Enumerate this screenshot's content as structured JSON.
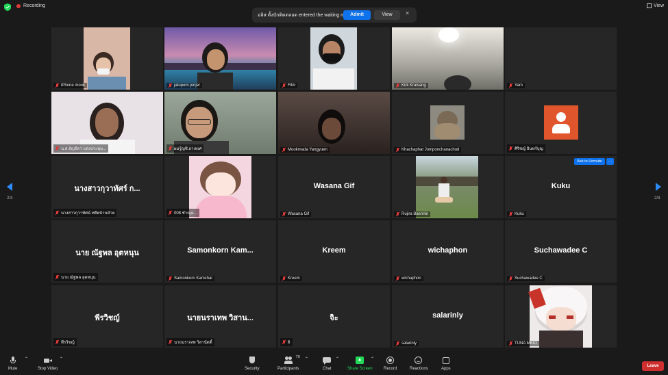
{
  "topbar": {
    "recording_label": "Recording",
    "view_label": "View"
  },
  "notification": {
    "message": "อลิส ตั้งบักติดตลอด entered the waiting room",
    "admit_label": "Admit",
    "view_label": "View",
    "close_glyph": "×"
  },
  "navigation": {
    "left_page": "2/3",
    "right_page": "2/3"
  },
  "tiles": [
    {
      "label": "iPhone mook",
      "center": ""
    },
    {
      "label": "jatuporn jonjer",
      "center": ""
    },
    {
      "label": "Film",
      "center": ""
    },
    {
      "label": "Kirk Kraisang",
      "center": ""
    },
    {
      "label": "Yam",
      "center": ""
    },
    {
      "label": "น.ส.ธัญธิดา แสงประทุม...",
      "center": ""
    },
    {
      "label": "ผมรู้ญชิ.ถาเทเศ",
      "center": ""
    },
    {
      "label": "Mookmada Yangyuen",
      "center": ""
    },
    {
      "label": "Khachaphat Jomponchanachod",
      "center": ""
    },
    {
      "label": "ศิริชญ์ อินทร์บุญ",
      "center": ""
    },
    {
      "label": "นางสาวกุวาทัศน์ ทศิตบ้านห้วย",
      "center": "นางสาวกุวาทัศร์ ก..."
    },
    {
      "label": "008 ชำณุฉ...",
      "center": ""
    },
    {
      "label": "Wasana Gif",
      "center": "Wasana Gif"
    },
    {
      "label": "Rujira Baennin",
      "center": ""
    },
    {
      "label": "Kuku",
      "center": "Kuku"
    },
    {
      "label": "นาย ณัฐพล อุตหนุน",
      "center": "นาย ณัฐพล อุตหนุน"
    },
    {
      "label": "Samonkorn Kamchai",
      "center": "Samonkorn  Kam..."
    },
    {
      "label": "Kreem",
      "center": "Kreem"
    },
    {
      "label": "wichaphon",
      "center": "wichaphon"
    },
    {
      "label": "Suchawadee C",
      "center": "Suchawadee C"
    },
    {
      "label": "พีรวิชญ์",
      "center": "พีรวิชญ์"
    },
    {
      "label": "นายนราเทพ วิสานัดดิ์",
      "center": "นายนราเทพ วิสาน..."
    },
    {
      "label": "จิ",
      "center": "จิะ"
    },
    {
      "label": "salarinly",
      "center": "salarinly"
    },
    {
      "label": "TUNA MBIO",
      "center": ""
    }
  ],
  "ask_to_unmute": {
    "label": "Ask to Unmute",
    "more": "···"
  },
  "toolbar": {
    "mute": "Mute",
    "stop_video": "Stop Video",
    "security": "Security",
    "participants": "Participants",
    "participants_count": "70",
    "chat": "Chat",
    "share_screen": "Share Screen",
    "record": "Record",
    "reactions": "Reactions",
    "apps": "Apps",
    "leave": "Leave"
  },
  "colors": {
    "accent": "#0e72ed",
    "share": "#23d959",
    "leave": "#d02f2f",
    "muted": "#e03b3b"
  }
}
